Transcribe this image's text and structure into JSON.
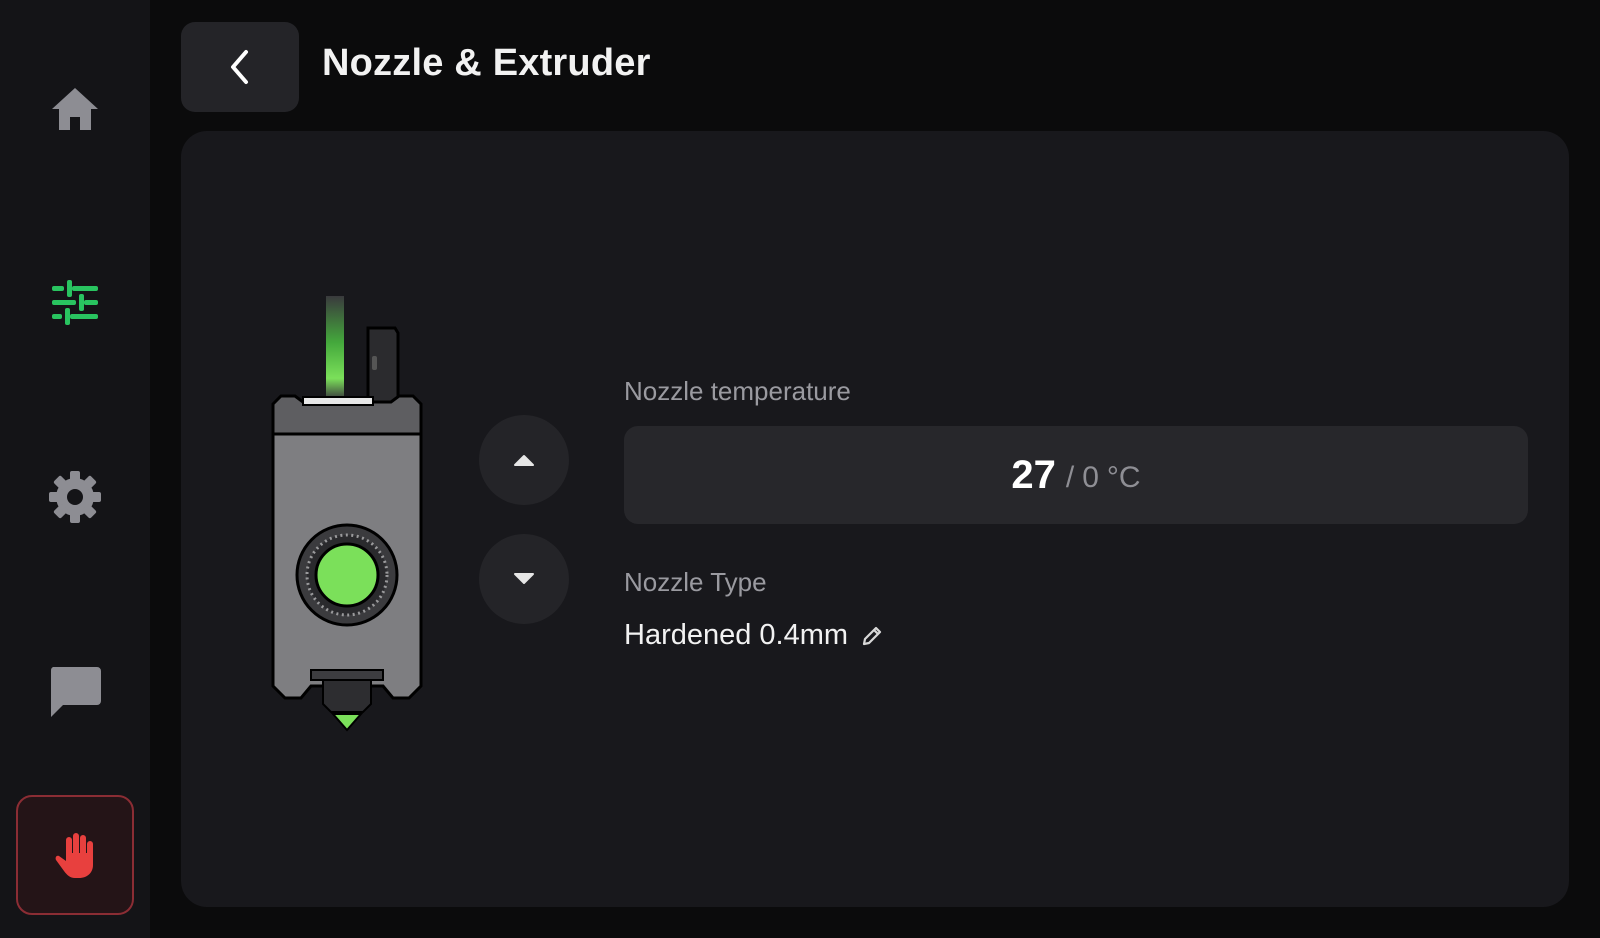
{
  "sidebar": {
    "items": [
      {
        "name": "home",
        "icon": "home-icon",
        "color": "#8d8d93"
      },
      {
        "name": "controls",
        "icon": "sliders-icon",
        "color": "#29c460",
        "active": true
      },
      {
        "name": "settings",
        "icon": "gear-icon",
        "color": "#8d8d93"
      },
      {
        "name": "messages",
        "icon": "chat-icon",
        "color": "#8d8d93"
      },
      {
        "name": "emergency-stop",
        "icon": "hand-stop-icon",
        "color": "#e8403e"
      }
    ]
  },
  "header": {
    "back_icon": "chevron-left-icon",
    "title": "Nozzle & Extruder"
  },
  "main": {
    "temperature": {
      "label": "Nozzle temperature",
      "current": "27",
      "separator": "/",
      "target": "0",
      "unit": "°C"
    },
    "nozzle_type": {
      "label": "Nozzle Type",
      "value": "Hardened 0.4mm",
      "edit_icon": "pencil-icon"
    },
    "extrude_up_icon": "caret-up-icon",
    "extrude_down_icon": "caret-down-icon",
    "accent_color": "#29c460"
  }
}
